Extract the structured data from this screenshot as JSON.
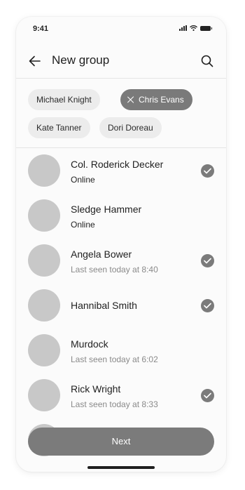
{
  "status_bar": {
    "time": "9:41"
  },
  "header": {
    "title": "New group",
    "back_icon": "arrow-left-icon",
    "search_icon": "search-icon"
  },
  "chips": [
    {
      "label": "Michael Knight",
      "selected": false
    },
    {
      "label": "Chris Evans",
      "selected": true
    },
    {
      "label": "Kate Tanner",
      "selected": false
    },
    {
      "label": "Dori Doreau",
      "selected": false
    }
  ],
  "contacts": [
    {
      "name": "Col. Roderick Decker",
      "status": "Online",
      "checked": true
    },
    {
      "name": "Sledge Hammer",
      "status": "Online",
      "checked": false
    },
    {
      "name": "Angela Bower",
      "status": "Last seen today at 8:40",
      "checked": true
    },
    {
      "name": "Hannibal Smith",
      "status": "",
      "checked": true
    },
    {
      "name": "Murdock",
      "status": "Last seen today at 6:02",
      "checked": false
    },
    {
      "name": "Rick Wright",
      "status": "Last seen today at 8:33",
      "checked": true
    }
  ],
  "footer": {
    "next_label": "Next"
  },
  "colors": {
    "accent": "#7b7b7b",
    "chip": "#ececec",
    "avatar": "#c8c8c8",
    "secondary_text": "#8a8a8a"
  }
}
